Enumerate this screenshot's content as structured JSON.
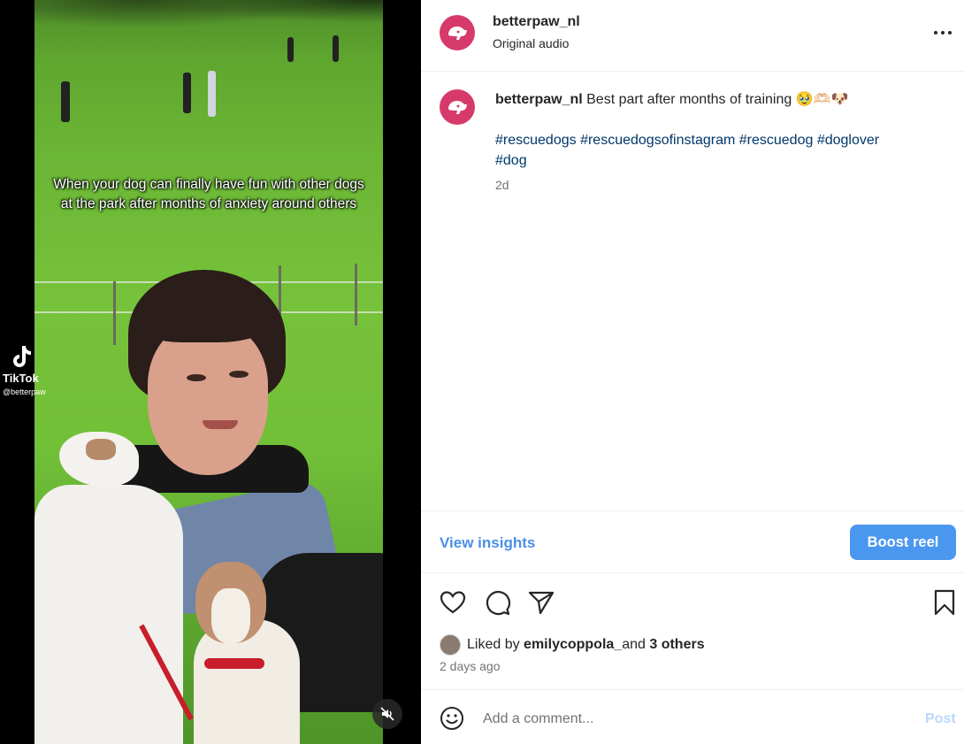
{
  "video": {
    "overlay_caption": "When your dog can finally have fun with other dogs at the park after months of anxiety around others",
    "watermark_app": "TikTok",
    "watermark_handle": "@betterpaw",
    "mute_icon": "muted-speaker-icon"
  },
  "header": {
    "username": "betterpaw_nl",
    "audio": "Original audio",
    "more_icon": "more-horizontal-icon"
  },
  "caption": {
    "username": "betterpaw_nl",
    "text": " Best part after months of training 🥹🫶🏻🐶",
    "hashtags": [
      "#rescuedogs",
      "#rescuedogsofinstagram",
      "#rescuedog",
      "#doglover",
      "#dog"
    ],
    "time": "2d"
  },
  "insights": {
    "view_label": "View insights",
    "boost_label": "Boost reel"
  },
  "actions": {
    "like_icon": "heart-icon",
    "comment_icon": "comment-icon",
    "share_icon": "send-icon",
    "save_icon": "bookmark-icon"
  },
  "likes": {
    "prefix": "Liked by ",
    "user": "emilycoppola_",
    "middle": " and ",
    "others": "3 others",
    "time": "2 days ago"
  },
  "comment": {
    "placeholder": "Add a comment...",
    "post_label": "Post"
  },
  "colors": {
    "brand_avatar": "#d63a6b",
    "link": "#00376b",
    "accent": "#4a97f0",
    "post_disabled": "#b9d8fb"
  }
}
